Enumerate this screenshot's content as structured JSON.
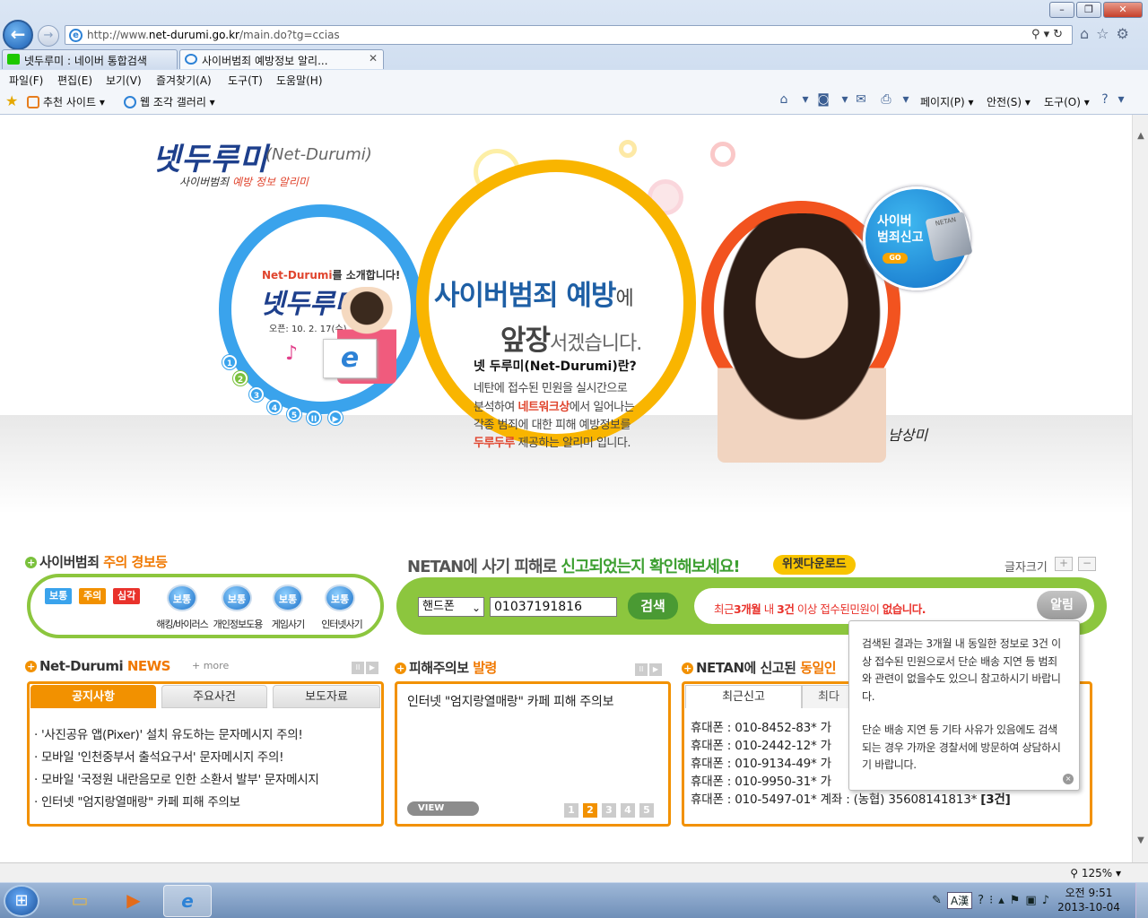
{
  "browser": {
    "url_prefix": "http://www.",
    "url_host": "net-durumi.go.kr",
    "url_path": "/main.do?tg=ccias",
    "tabs": [
      {
        "label": "넷두루미 : 네이버 통합검색"
      },
      {
        "label": "사이버범죄 예방정보 알리..."
      }
    ],
    "menu": [
      "파일(F)",
      "편집(E)",
      "보기(V)",
      "즐겨찾기(A)",
      "도구(T)",
      "도움말(H)"
    ],
    "favorites": [
      "추천 사이트 ▾",
      "웹 조각 갤러리 ▾"
    ],
    "commands": [
      "페이지(P) ▾",
      "안전(S) ▾",
      "도구(O) ▾"
    ],
    "zoom": "125%"
  },
  "hero": {
    "logo_title": "넷두루미",
    "logo_eng": "(Net-Durumi)",
    "logo_sub_1": "사이버범죄 ",
    "logo_sub_2": "예방 정보 알리미",
    "intro_1": "Net-Durumi",
    "intro_2": "를 소개합니다!",
    "intro_big": "넷두루미",
    "intro_date": "오픈: 10. 2. 17(수)",
    "dots": [
      "1",
      "2",
      "3",
      "4",
      "5",
      "II",
      "▶"
    ],
    "headline_1": "사이버범죄 예방",
    "headline_1_suffix": "에",
    "headline_2": "앞장",
    "headline_2_suffix": "서겠습니다.",
    "what_title": "넷 두루미(Net-Durumi)란?",
    "what_line1": "네탄에 접수된 민원을 실시간으로",
    "what_line2_pre": "분석하여 ",
    "what_line2_em": "네트워크상",
    "what_line2_post": "에서 일어나는",
    "what_line3": "각종 범죄에 대한 피해 예방정보를",
    "what_line4_em": "두루두루",
    "what_line4_post": " 제공하는 알리미 입니다.",
    "signature": "남상미",
    "report_line1": "사이버",
    "report_line2": "범죄신고",
    "report_go": "GO",
    "laptop_label": "NETAN"
  },
  "alert": {
    "title_pre": "사이버범죄 ",
    "title_em": "주의 경보등",
    "levels": [
      "보통",
      "주의",
      "심각"
    ],
    "items": [
      {
        "status": "보통",
        "label": "해킹/바이러스"
      },
      {
        "status": "보통",
        "label": "개인정보도용"
      },
      {
        "status": "보통",
        "label": "게임사기"
      },
      {
        "status": "보통",
        "label": "인터넷사기"
      }
    ]
  },
  "netan_search": {
    "title_1": "NETAN",
    "title_2": "에 사기 피해로 ",
    "title_3": "신고되었는지 확인해보세요!",
    "widget_label": "위젯다운로드",
    "font_size_label": "글자크기",
    "font_plus": "+",
    "font_minus": "−",
    "select_value": "핸드폰",
    "input_value": "01037191816",
    "search_label": "검색",
    "result_1": "최근",
    "result_2": "3개월",
    "result_3": " 내 ",
    "result_4": "3건",
    "result_5": " 이상 접수된민원이 ",
    "result_6": "없습니다.",
    "notice_label": "알림"
  },
  "news": {
    "title_1": "Net-Durumi ",
    "title_2": "NEWS",
    "more": "+ more",
    "tabs": [
      "공지사항",
      "주요사건",
      "보도자료"
    ],
    "items": [
      "· '사진공유 앱(Pixer)' 설치 유도하는 문자메시지 주의!",
      "· 모바일 '인천중부서 출석요구서' 문자메시지 주의!",
      "· 모바일 '국정원 내란음모로 인한 소환서 발부' 문자메시지",
      "· 인터넷 \"엄지랑열매랑\" 카페 피해 주의보"
    ]
  },
  "warning": {
    "title_1": "피해주의보 ",
    "title_2": "발령",
    "text": "인터넷 \"엄지랑열매랑\" 카페 피해 주의보",
    "view": "VIEW",
    "pages": [
      "1",
      "2",
      "3",
      "4",
      "5"
    ],
    "current_page": "2"
  },
  "netan_records": {
    "title_1": "NETAN",
    "title_2": "에 신고된 ",
    "title_3": "동일인",
    "tab_recent": "최근신고",
    "tab_most": "최다",
    "lines": [
      "휴대폰 : 010-8452-83* 가",
      "휴대폰 : 010-2442-12* 가",
      "휴대폰 : 010-9134-49* 가",
      "휴대폰 : 010-9950-31* 가"
    ],
    "last_line_1": "휴대폰 : 010-5497-01* 계좌 : (농협) 35608141813* ",
    "last_line_2": "[3건]"
  },
  "tooltip": {
    "para1": "검색된 결과는 3개월 내 동일한 정보로 3건 이상 접수된 민원으로서 단순 배송 지연 등 범죄와 관련이 없을수도 있으니 참고하시기 바랍니다.",
    "para2": "단순 배송 지연 등 기타 사유가 있음에도 검색되는 경우 가까운 경찰서에 방문하여 상담하시기 바랍니다.",
    "close": "×"
  },
  "taskbar": {
    "ime": "A漢",
    "time": "오전 9:51",
    "date": "2013-10-04"
  },
  "colors": {
    "green": "#8cc63e",
    "orange": "#f29100",
    "blue": "#3aa3ec",
    "red": "#e9322b"
  }
}
